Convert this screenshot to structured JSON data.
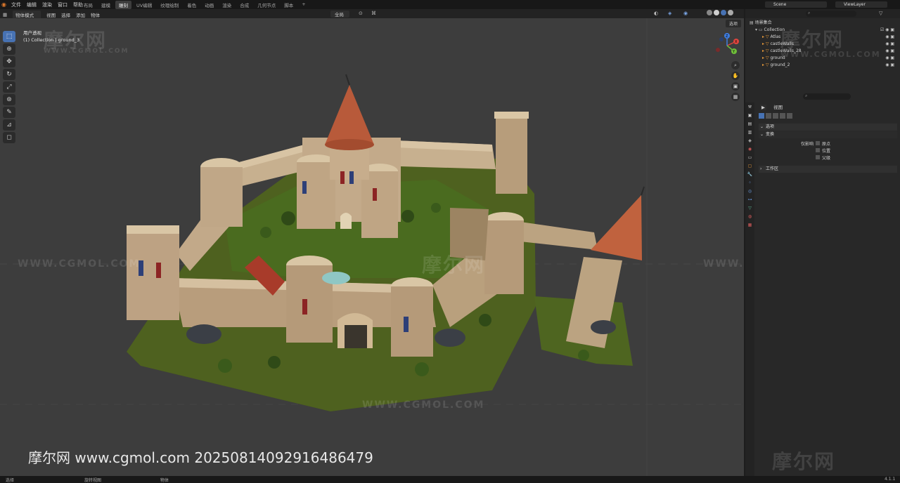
{
  "topbar": {
    "menus": [
      "文件",
      "编辑",
      "渲染",
      "窗口",
      "帮助"
    ],
    "workspace_tabs": [
      "布局",
      "建模",
      "雕刻",
      "UV编辑",
      "纹理绘制",
      "着色",
      "动画",
      "渲染",
      "合成",
      "几何节点",
      "脚本",
      "+"
    ],
    "active_tab_index": 2,
    "scene": "Scene",
    "view_layer": "ViewLayer"
  },
  "viewport_header": {
    "mode": "物体模式",
    "menus": [
      "视图",
      "选择",
      "添加",
      "物体"
    ],
    "transform_orientation": "全局",
    "options": "选项"
  },
  "viewport": {
    "view_name": "用户透视",
    "context": "(1) Collection | ground_3"
  },
  "toolbar": {
    "tools": [
      "select-icon",
      "cursor-icon",
      "move-icon",
      "rotate-icon",
      "scale-icon",
      "transform-icon",
      "annotate-icon",
      "measure-icon",
      "add-cube-icon"
    ]
  },
  "gizmo": {
    "x": "X",
    "y": "Y",
    "z": "Z"
  },
  "outliner": {
    "root": "场景集合",
    "collection": "Collection",
    "items": [
      "Atlas",
      "castleWalls",
      "castleWalls_28",
      "ground",
      "ground_2"
    ]
  },
  "properties": {
    "title": "视图",
    "sections": {
      "relations": "选项",
      "transform": "变换",
      "affect_only_label": "仅影响",
      "origins": "原点",
      "locations": "位置",
      "parents": "父级",
      "workspace": "工作区"
    }
  },
  "watermarks": {
    "cn": "摩尔网",
    "url": "WWW.CGMOL.COM",
    "credit": "摩尔网 www.cgmol.com 20250814092916486479"
  },
  "statusbar": {
    "left": "选择",
    "middle": "旋转视图",
    "right": "物体",
    "version": "4.1.1"
  },
  "colors": {
    "accent": "#4772b3",
    "viewport_bg": "#3d3d3d",
    "panel_bg": "#282828",
    "header_bg": "#232323"
  }
}
